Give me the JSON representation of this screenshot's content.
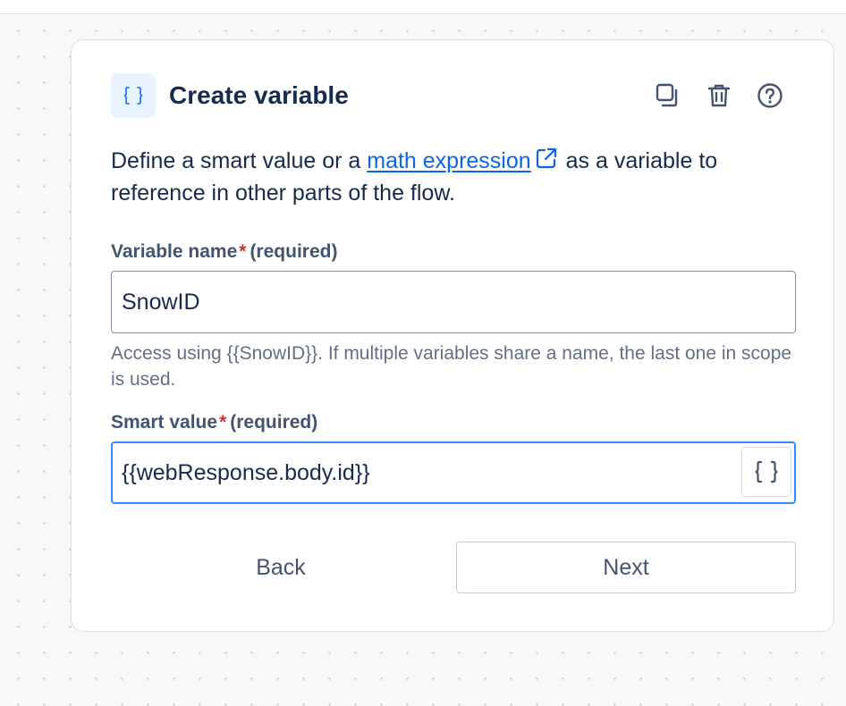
{
  "panel": {
    "title": "Create variable",
    "type_icon": "curly-braces-icon",
    "actions": {
      "duplicate_icon": "duplicate-icon",
      "delete_icon": "trash-icon",
      "help_icon": "help-icon"
    },
    "description": {
      "before_link": "Define a smart value or a ",
      "link_text": "math expression",
      "link_icon": "external-link-icon",
      "after_link": " as a variable to reference in other parts of the flow."
    },
    "variable_name": {
      "label": "Variable name",
      "required_marker": "*",
      "required_text": "(required)",
      "value": "SnowID",
      "helper": "Access using {{SnowID}}. If multiple variables share a name, the last one in scope is used."
    },
    "smart_value": {
      "label": "Smart value",
      "required_marker": "*",
      "required_text": "(required)",
      "value": "{{webResponse.body.id}}",
      "insert_icon": "curly-braces-icon"
    },
    "buttons": {
      "back": "Back",
      "next": "Next"
    }
  },
  "colors": {
    "accent": "#0c66e4",
    "focus_border": "#388bff",
    "required": "#c9372c",
    "badge_background": "#e9f2ff"
  }
}
